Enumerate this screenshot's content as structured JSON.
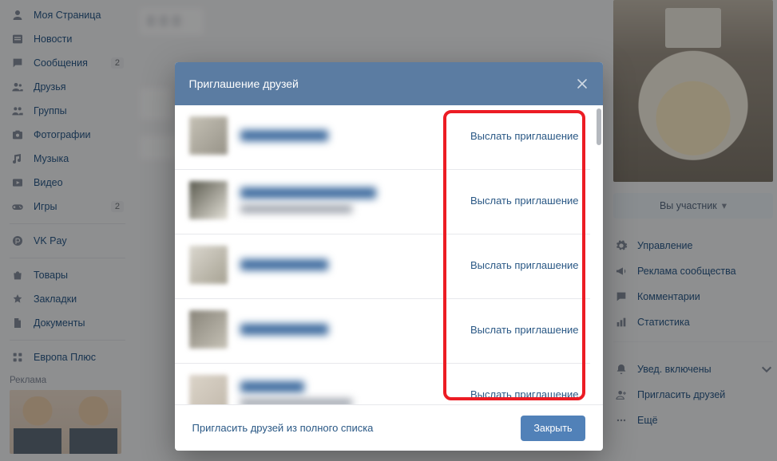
{
  "sidebar": {
    "items": [
      {
        "icon": "user-icon",
        "label": "Моя Страница"
      },
      {
        "icon": "news-icon",
        "label": "Новости"
      },
      {
        "icon": "message-icon",
        "label": "Сообщения",
        "badge": "2"
      },
      {
        "icon": "friends-icon",
        "label": "Друзья"
      },
      {
        "icon": "group-icon",
        "label": "Группы"
      },
      {
        "icon": "photo-icon",
        "label": "Фотографии"
      },
      {
        "icon": "music-icon",
        "label": "Музыка"
      },
      {
        "icon": "video-icon",
        "label": "Видео"
      },
      {
        "icon": "game-icon",
        "label": "Игры",
        "badge": "2"
      },
      {
        "icon": "pay-icon",
        "label": "VK Pay"
      },
      {
        "icon": "bag-icon",
        "label": "Товары"
      },
      {
        "icon": "star-icon",
        "label": "Закладки"
      },
      {
        "icon": "doc-icon",
        "label": "Документы"
      },
      {
        "icon": "app-icon",
        "label": "Европа Плюс"
      }
    ],
    "ad_label": "Реклама"
  },
  "right": {
    "member_label": "Вы участник",
    "actions_a": [
      {
        "icon": "gear-icon",
        "label": "Управление"
      },
      {
        "icon": "horn-icon",
        "label": "Реклама сообщества"
      },
      {
        "icon": "comment-icon",
        "label": "Комментарии"
      },
      {
        "icon": "stats-icon",
        "label": "Статистика"
      }
    ],
    "actions_b": [
      {
        "icon": "bell-icon",
        "label": "Увед. включены",
        "chevron": true
      },
      {
        "icon": "invite-icon",
        "label": "Пригласить друзей"
      },
      {
        "icon": "more-icon",
        "label": "Ещё"
      }
    ]
  },
  "modal": {
    "title": "Приглашение друзей",
    "invite_label": "Выслать приглашение",
    "full_list_label": "Пригласить друзей из полного списка",
    "close_label": "Закрыть",
    "friends_count": 5
  }
}
